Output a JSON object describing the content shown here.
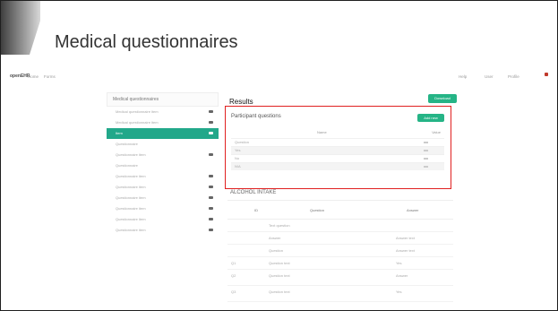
{
  "slide": {
    "title": "Medical questionnaires"
  },
  "nav": {
    "logo": "openEHR",
    "links": [
      "Home",
      "Forms"
    ],
    "right_items": [
      "Help",
      "User",
      "Profile"
    ]
  },
  "panel": {
    "header": "Medical questionnaires",
    "items": [
      {
        "label": "Medical questionnaire item",
        "active": false,
        "badge": true
      },
      {
        "label": "Medical questionnaire item",
        "active": false,
        "badge": true
      },
      {
        "label": "Item",
        "active": true,
        "badge": true
      },
      {
        "label": "Questionnaire",
        "active": false,
        "badge": false
      },
      {
        "label": "Questionnaire item",
        "active": false,
        "badge": true
      },
      {
        "label": "Questionnaire",
        "active": false,
        "badge": false
      },
      {
        "label": "Questionnaire item",
        "active": false,
        "badge": true
      },
      {
        "label": "Questionnaire item",
        "active": false,
        "badge": true
      },
      {
        "label": "Questionnaire item",
        "active": false,
        "badge": true
      },
      {
        "label": "Questionnaire item",
        "active": false,
        "badge": true
      },
      {
        "label": "Questionnaire item",
        "active": false,
        "badge": true
      },
      {
        "label": "Questionnaire item",
        "active": false,
        "badge": true
      }
    ]
  },
  "results": {
    "title": "Results",
    "top_button": "Download",
    "box_title": "Participant questions",
    "box_button": "Add new",
    "columns": [
      "Name",
      "Value"
    ],
    "rows": [
      "Question",
      "Yes",
      "No",
      "N/A"
    ],
    "section2_title": "ALCOHOL INTAKE",
    "table2_cols": [
      "ID",
      "Question",
      "Answer"
    ],
    "table2_rows": [
      {
        "id": "",
        "q": "Text question",
        "a": ""
      },
      {
        "id": "",
        "q": "Answer",
        "a": "Answer text"
      },
      {
        "id": "",
        "q": "Question",
        "a": "Answer text"
      },
      {
        "id": "Q1",
        "q": "Question text",
        "a": "Yes"
      },
      {
        "id": "Q2",
        "q": "Question text",
        "a": "Answer"
      },
      {
        "id": "Q3",
        "q": "Question text",
        "a": "Yes"
      }
    ]
  },
  "colors": {
    "accent": "#22a88a",
    "highlight": "#e02020"
  }
}
